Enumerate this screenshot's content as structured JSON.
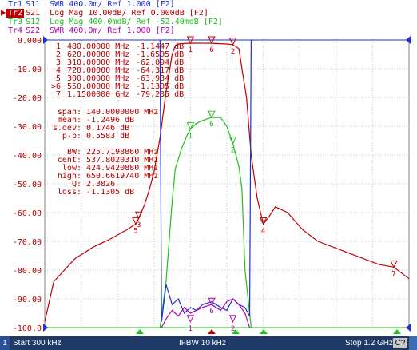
{
  "traces": [
    {
      "id": "Tr1",
      "label": "Tr1",
      "text": "S11  SWR 400.0m/ Ref 1.000 [F2]",
      "color": "#1f2fd8"
    },
    {
      "id": "Tr2",
      "label": "Tr2",
      "text": "S21  Log Mag 10.00dB/ Ref 0.000dB [F2]",
      "color": "#b00000"
    },
    {
      "id": "Tr3",
      "label": "Tr3",
      "text": "S12  Log Mag 400.0mdB/ Ref -52.40mdB [F2]",
      "color": "#20c020"
    },
    {
      "id": "Tr4",
      "label": "Tr4",
      "text": "S22  SWR 400.0m/ Ref 1.000 [F2]",
      "color": "#b000b0"
    }
  ],
  "markers": [
    {
      "num": "1",
      "freq": "480.00000 MHz",
      "val": "-1.1447 dB"
    },
    {
      "num": "2",
      "freq": "620.00000 MHz",
      "val": "-1.6505 dB"
    },
    {
      "num": "3",
      "freq": "310.00000 MHz",
      "val": "-62.094 dB"
    },
    {
      "num": "4",
      "freq": "720.00000 MHz",
      "val": "-64.317 dB"
    },
    {
      "num": "5",
      "freq": "300.00000 MHz",
      "val": "-63.934 dB"
    },
    {
      "num": ">6",
      "freq": "550.00000 MHz",
      "val": "-1.1305 dB"
    },
    {
      "num": "7",
      "freq": "1.1500000 GHz",
      "val": "-79.235 dB"
    }
  ],
  "stats": [
    {
      "label": "span:",
      "val": "140.0000000 MHz"
    },
    {
      "label": "mean:",
      "val": "-1.2496 dB"
    },
    {
      "label": "s.dev:",
      "val": "0.1746 dB"
    },
    {
      "label": "p-p:",
      "val": "0.5583 dB"
    }
  ],
  "bw": [
    {
      "label": "BW:",
      "val": "225.7198860 MHz"
    },
    {
      "label": "cent:",
      "val": "537.8020310 MHz"
    },
    {
      "label": "low:",
      "val": "424.9420880 MHz"
    },
    {
      "label": "high:",
      "val": "650.6619740 MHz"
    },
    {
      "label": "Q:",
      "val": "2.3826"
    },
    {
      "label": "loss:",
      "val": "-1.1305 dB"
    }
  ],
  "yticks": [
    "0.000",
    "-10.00",
    "-20.00",
    "-30.00",
    "-40.00",
    "-50.00",
    "-60.00",
    "-70.00",
    "-80.00",
    "-90.00",
    "-100.0"
  ],
  "chart_data": {
    "type": "line",
    "xrange_MHz": [
      0.3,
      1200
    ],
    "ylim": [
      -100,
      0
    ],
    "grid": true,
    "series": [
      {
        "name": "S21",
        "color": "#c00000",
        "x": [
          0.3,
          30,
          100,
          160,
          220,
          270,
          300,
          310,
          330,
          345,
          360,
          380,
          400,
          420,
          430,
          445,
          470,
          480,
          500,
          550,
          600,
          620,
          640,
          650,
          665,
          680,
          700,
          720,
          735,
          760,
          800,
          850,
          900,
          1000,
          1100,
          1150,
          1200
        ],
        "y": [
          -98,
          -84,
          -76,
          -72,
          -69,
          -66,
          -64,
          -62,
          -57,
          -52,
          -46,
          -34,
          -18,
          -5,
          -2,
          -1.3,
          -1.15,
          -1.14,
          -1.1,
          -1.13,
          -1.4,
          -1.65,
          -3,
          -10,
          -20,
          -40,
          -55,
          -64,
          -62,
          -58,
          -60,
          -66,
          -70,
          -74,
          -78,
          -79,
          -83
        ]
      },
      {
        "name": "S12",
        "color": "#20c020",
        "x": [
          380,
          400,
          420,
          430,
          450,
          470,
          480,
          500,
          520,
          550,
          580,
          600,
          620,
          640,
          650,
          660,
          680
        ],
        "y": [
          -100,
          -84,
          -56,
          -45,
          -38,
          -33,
          -31,
          -29,
          -28,
          -27,
          -27,
          -30,
          -36,
          -44,
          -52,
          -80,
          -100
        ]
      },
      {
        "name": "S11",
        "color": "#1f2fd8",
        "x": [
          380,
          385,
          400,
          420,
          440,
          460,
          480,
          500,
          520,
          550,
          580,
          600,
          620,
          640,
          660,
          675,
          680
        ],
        "y": [
          0,
          -98,
          -85,
          -92,
          -90,
          -95,
          -93,
          -94,
          -92,
          -91,
          -93,
          -94,
          -90,
          -92,
          -93,
          -96,
          0
        ]
      },
      {
        "name": "S22",
        "color": "#b000b0",
        "x": [
          385,
          400,
          420,
          440,
          460,
          480,
          500,
          520,
          550,
          580,
          600,
          620,
          640,
          660,
          675
        ],
        "y": [
          -100,
          -97,
          -94,
          -96,
          -93,
          -95,
          -94,
          -93,
          -92,
          -94,
          -91,
          -90,
          -92,
          -95,
          -100
        ]
      }
    ]
  },
  "marker_flags": [
    {
      "trace": "S21",
      "label": "1",
      "x_MHz": 480,
      "y": -1.1
    },
    {
      "trace": "S21",
      "label": "2",
      "x_MHz": 620,
      "y": -1.6
    },
    {
      "trace": "S21",
      "label": "6",
      "x_MHz": 550,
      "y": -1.1
    },
    {
      "trace": "S21",
      "label": "3",
      "x_MHz": 310,
      "y": -62
    },
    {
      "trace": "S21",
      "label": "5",
      "x_MHz": 300,
      "y": -64
    },
    {
      "trace": "S21",
      "label": "4",
      "x_MHz": 720,
      "y": -64
    },
    {
      "trace": "S21",
      "label": "7",
      "x_MHz": 1150,
      "y": -79
    },
    {
      "trace": "S12",
      "label": "1",
      "x_MHz": 480,
      "y": -31
    },
    {
      "trace": "S12",
      "label": "6",
      "x_MHz": 550,
      "y": -27
    },
    {
      "trace": "S12",
      "label": "2",
      "x_MHz": 620,
      "y": -36
    },
    {
      "trace": "S22",
      "label": "6",
      "x_MHz": 550,
      "y": -92
    },
    {
      "trace": "S22",
      "label": "1",
      "x_MHz": 480,
      "y": -98
    },
    {
      "trace": "S22",
      "label": "2",
      "x_MHz": 620,
      "y": -98
    }
  ],
  "status": {
    "ch": "1",
    "start": "Start 300 kHz",
    "ifbw": "IFBW 10 kHz",
    "stop": "Stop 1.2 GHz",
    "c": "C?"
  }
}
